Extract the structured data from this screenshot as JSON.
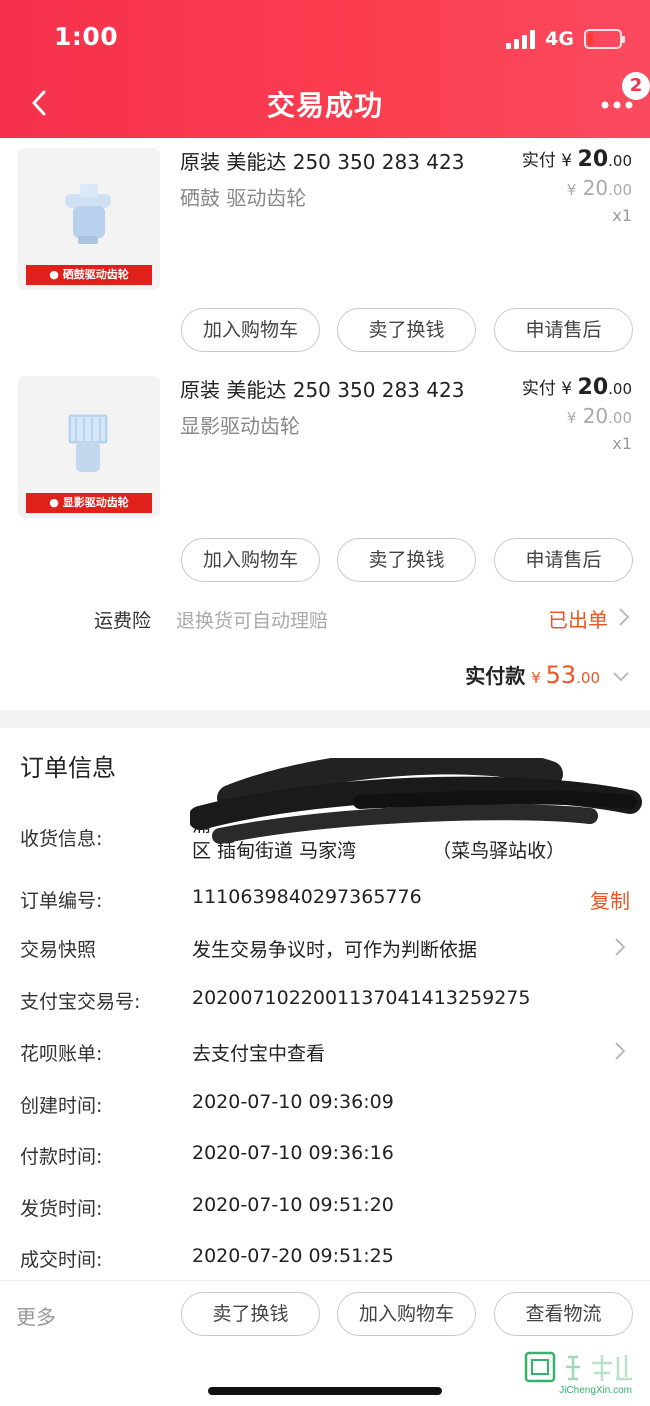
{
  "status_bar": {
    "time": "1:00",
    "network": "4G"
  },
  "header": {
    "title": "交易成功",
    "badge_count": "2"
  },
  "products": [
    {
      "title": "原装 美能达 250 350 283 423",
      "subtitle": "硒鼓 驱动齿轮",
      "thumb_label": "硒鼓驱动齿轮",
      "paid_prefix": "实付",
      "currency": "¥",
      "paid_amount": "20",
      "paid_cents": ".00",
      "orig_amount": "20",
      "orig_cents": ".00",
      "qty": "x1",
      "buttons": [
        "加入购物车",
        "卖了换钱",
        "申请售后"
      ]
    },
    {
      "title": "原装 美能达 250 350 283 423",
      "subtitle": "显影驱动齿轮",
      "thumb_label": "显影驱动齿轮",
      "paid_prefix": "实付",
      "currency": "¥",
      "paid_amount": "20",
      "paid_cents": ".00",
      "orig_amount": "20",
      "orig_cents": ".00",
      "qty": "x1",
      "buttons": [
        "加入购物车",
        "卖了换钱",
        "申请售后"
      ]
    }
  ],
  "insurance": {
    "label": "运费险",
    "desc": "退换货可自动理赔",
    "status": "已出单"
  },
  "total": {
    "label": "实付款",
    "currency": "¥",
    "amount": "53",
    "cents": ".00"
  },
  "order_info": {
    "section_title": "订单信息",
    "address": {
      "label": "收货信息:",
      "line1": "蒲",
      "line2": "区 插甸街道 马家湾",
      "line3": "（菜鸟驿站收）"
    },
    "rows": [
      {
        "label": "订单编号:",
        "value": "1110639840297365776",
        "action": "复制"
      },
      {
        "label": "交易快照",
        "value": "发生交易争议时，可作为判断依据"
      },
      {
        "label": "支付宝交易号:",
        "value": "2020071022001137041413259275"
      },
      {
        "label": "花呗账单:",
        "value": "去支付宝中查看"
      },
      {
        "label": "创建时间:",
        "value": "2020-07-10 09:36:09"
      },
      {
        "label": "付款时间:",
        "value": "2020-07-10 09:36:16"
      },
      {
        "label": "发货时间:",
        "value": "2020-07-10 09:51:20"
      },
      {
        "label": "成交时间:",
        "value": "2020-07-20 09:51:25"
      }
    ]
  },
  "footer": {
    "more": "更多",
    "buttons": [
      "卖了换钱",
      "加入购物车",
      "查看物流"
    ]
  },
  "watermark": {
    "chars": "集诚信",
    "domain": "JiChengXin.com"
  },
  "colors": {
    "header": "#f6304c",
    "accent": "#ee5522",
    "thumb_tag": "#e0201a"
  }
}
